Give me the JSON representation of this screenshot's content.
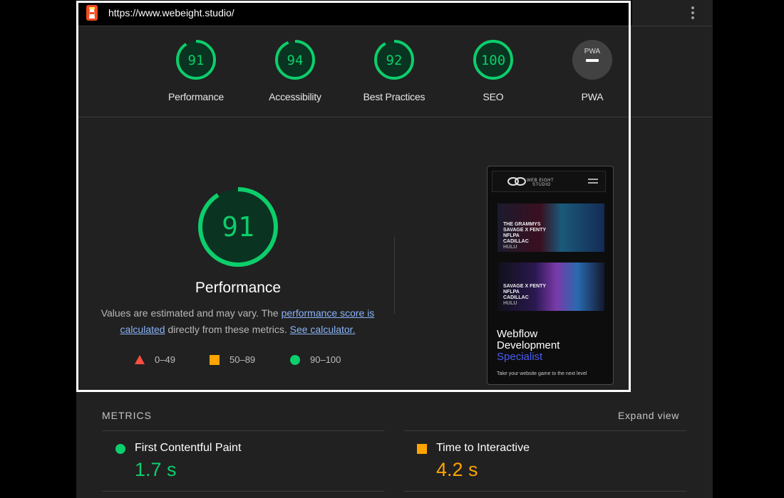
{
  "header": {
    "url": "https://www.webeight.studio/"
  },
  "colors": {
    "pass": "#0cce6b",
    "average": "#ffa400",
    "fail": "#ff4e42",
    "link": "#8ab4f8"
  },
  "gauges": [
    {
      "label": "Performance",
      "score": "91",
      "value": 0.91
    },
    {
      "label": "Accessibility",
      "score": "94",
      "value": 0.94
    },
    {
      "label": "Best Practices",
      "score": "92",
      "value": 0.92
    },
    {
      "label": "SEO",
      "score": "100",
      "value": 1.0
    },
    {
      "label": "PWA",
      "badge": "PWA",
      "score": ""
    }
  ],
  "performance": {
    "score": "91",
    "value": 0.91,
    "title": "Performance",
    "desc_prefix": "Values are estimated and may vary. The ",
    "desc_link1": "performance score is calculated",
    "desc_mid": " directly from these metrics. ",
    "desc_link2": "See calculator.",
    "legend": [
      {
        "icon": "triangle-fail-icon",
        "range": "0–49"
      },
      {
        "icon": "square-average-icon",
        "range": "50–89"
      },
      {
        "icon": "circle-pass-icon",
        "range": "90–100"
      }
    ]
  },
  "screenshot": {
    "brand_line1": "WEB EIGHT",
    "brand_line2": "STUDIO",
    "card1": [
      "THE GRAMMYS",
      "SAVAGE X FENTY",
      "NFLPA",
      "CADILLAC",
      "HULU"
    ],
    "card2": [
      "SAVAGE X FENTY",
      "NFLPA",
      "CADILLAC",
      "HULU"
    ],
    "hero_line1": "Webflow",
    "hero_line2": "Development",
    "hero_accent": "Specialist",
    "hero_sub": "Take your website game to the next level"
  },
  "metrics": {
    "title": "METRICS",
    "expand_label": "Expand view",
    "items": [
      {
        "name": "First Contentful Paint",
        "value": "1.7 s",
        "status": "pass"
      },
      {
        "name": "Time to Interactive",
        "value": "4.2 s",
        "status": "average"
      }
    ]
  }
}
